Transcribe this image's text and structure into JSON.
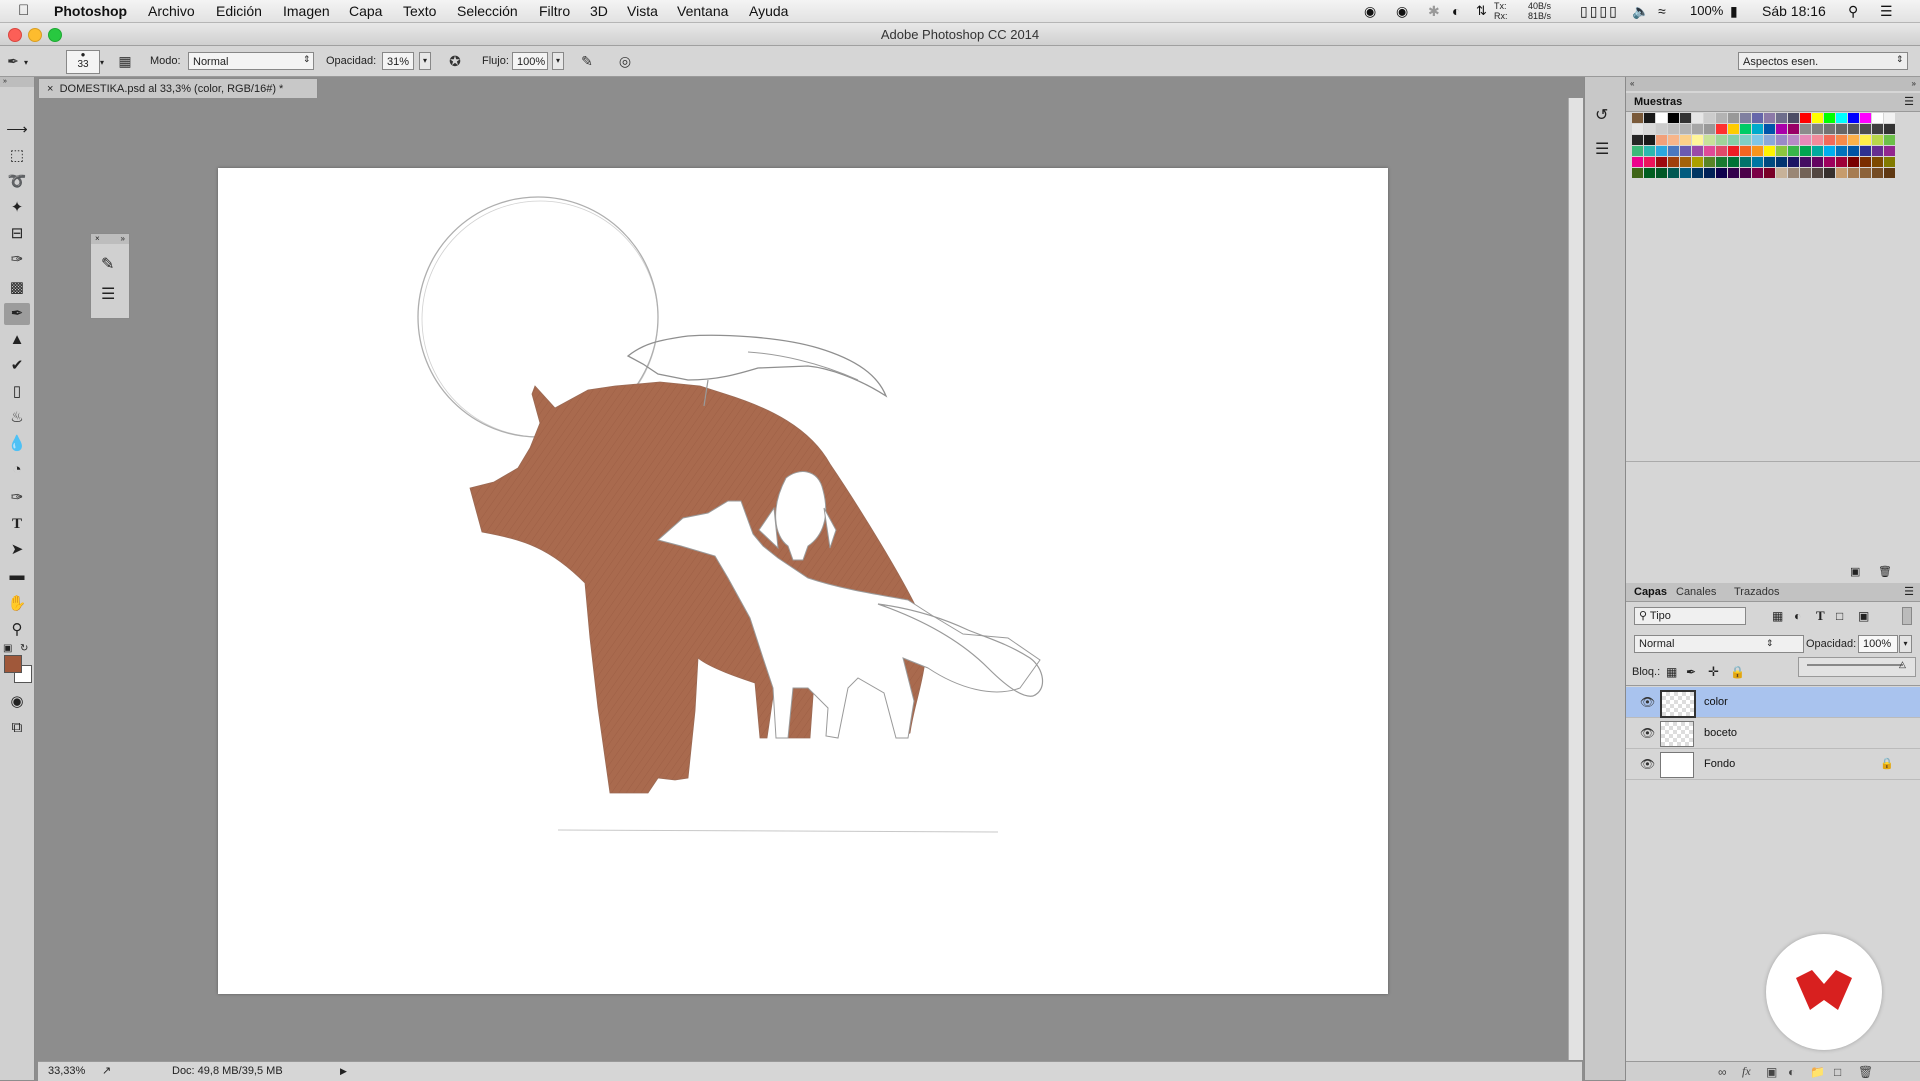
{
  "menubar": {
    "app_name": "Photoshop",
    "items": [
      "Archivo",
      "Edición",
      "Imagen",
      "Capa",
      "Texto",
      "Selección",
      "Filtro",
      "3D",
      "Vista",
      "Ventana",
      "Ayuda"
    ],
    "net_tx": "40B/s",
    "net_rx": "81B/s",
    "net_tx_label": "Tx:",
    "net_rx_label": "Rx:",
    "battery": "100%",
    "clock": "Sáb 18:16"
  },
  "window": {
    "title": "Adobe Photoshop CC 2014"
  },
  "options": {
    "brush_size": "33",
    "mode_label": "Modo:",
    "mode_value": "Normal",
    "opacity_label": "Opacidad:",
    "opacity_value": "31%",
    "flow_label": "Flujo:",
    "flow_value": "100%",
    "workspace": "Aspectos esen."
  },
  "document": {
    "tab_title": "DOMESTIKA.psd al 33,3% (color, RGB/16#) *",
    "zoom": "33,33%",
    "doc_size": "Doc: 49,8 MB/39,5 MB"
  },
  "swatches": {
    "title": "Muestras",
    "colors": [
      "#7a5a3a",
      "#1a1a1a",
      "#ffffff",
      "#000000",
      "#333333",
      "#e6e6e6",
      "#cccccc",
      "#b3b3b3",
      "#999999",
      "#8080a0",
      "#6666aa",
      "#8c7aa8",
      "#6e6e8c",
      "#4d4d66",
      "#ff0000",
      "#ffff00",
      "#00ff00",
      "#00ffff",
      "#0000ff",
      "#ff00ff",
      "#ffffff",
      "#f2f2f2",
      "#e6e6e6",
      "#d9d9d9",
      "#cccccc",
      "#bfbfbf",
      "#b3b3b3",
      "#a6a6a6",
      "#999999",
      "#ff3030",
      "#ffcc00",
      "#00cc66",
      "#00aacc",
      "#0055aa",
      "#aa00aa",
      "#990066",
      "#8c8c8c",
      "#808080",
      "#737373",
      "#666666",
      "#595959",
      "#4d4d4d",
      "#404040",
      "#333333",
      "#262626",
      "#1a1a1a",
      "#f2a07a",
      "#f7b58a",
      "#fbd08a",
      "#fff59a",
      "#c8e29a",
      "#9fd59a",
      "#85cfa8",
      "#80cfc6",
      "#7fc6e6",
      "#8aa8d8",
      "#9a8ac8",
      "#b88ac6",
      "#e68ab8",
      "#f28a9a",
      "#f26a5a",
      "#f58a4a",
      "#fbb04a",
      "#fff04a",
      "#b8d84a",
      "#6cc04a",
      "#3cb878",
      "#2cb8b0",
      "#2ca8e0",
      "#4a78c0",
      "#6a5ab0",
      "#9a4aa8",
      "#e04a98",
      "#e04a6a",
      "#ed1c24",
      "#f26522",
      "#f7941d",
      "#fff200",
      "#8dc63f",
      "#39b54a",
      "#00a651",
      "#00a99d",
      "#00aeef",
      "#0072bc",
      "#0054a6",
      "#2e3192",
      "#662d91",
      "#92278f",
      "#ec008c",
      "#ed145b",
      "#9e0b0f",
      "#a0410d",
      "#a36209",
      "#aba000",
      "#598527",
      "#197b30",
      "#007236",
      "#00746b",
      "#0076a3",
      "#004a80",
      "#003471",
      "#1b1464",
      "#440e62",
      "#630460",
      "#9e005d",
      "#9e0039",
      "#790000",
      "#7b2e00",
      "#7d4900",
      "#827b00",
      "#406618",
      "#005e20",
      "#005826",
      "#005952",
      "#005b7f",
      "#003663",
      "#002157",
      "#0d004c",
      "#32004b",
      "#4b0049",
      "#7b0046",
      "#7a0026",
      "#c7b299",
      "#998675",
      "#736357",
      "#534741",
      "#37302d",
      "#c69c6d",
      "#a67c52",
      "#8c6239",
      "#754c24",
      "#603913"
    ]
  },
  "layers_panel": {
    "tabs": [
      "Capas",
      "Canales",
      "Trazados"
    ],
    "filter": "Tipo",
    "blend_mode": "Normal",
    "opacity_label": "Opacidad:",
    "opacity_value": "100%",
    "lock_label": "Bloq.:",
    "layers": [
      {
        "name": "color",
        "selected": true,
        "locked": false
      },
      {
        "name": "boceto",
        "selected": false,
        "locked": false
      },
      {
        "name": "Fondo",
        "selected": false,
        "locked": true
      }
    ]
  },
  "colors": {
    "foreground": "#a0583a",
    "background": "#ffffff",
    "bear_fill": "#a96a4e",
    "selection": "#a9c3ee",
    "brand_red": "#d8201f"
  }
}
